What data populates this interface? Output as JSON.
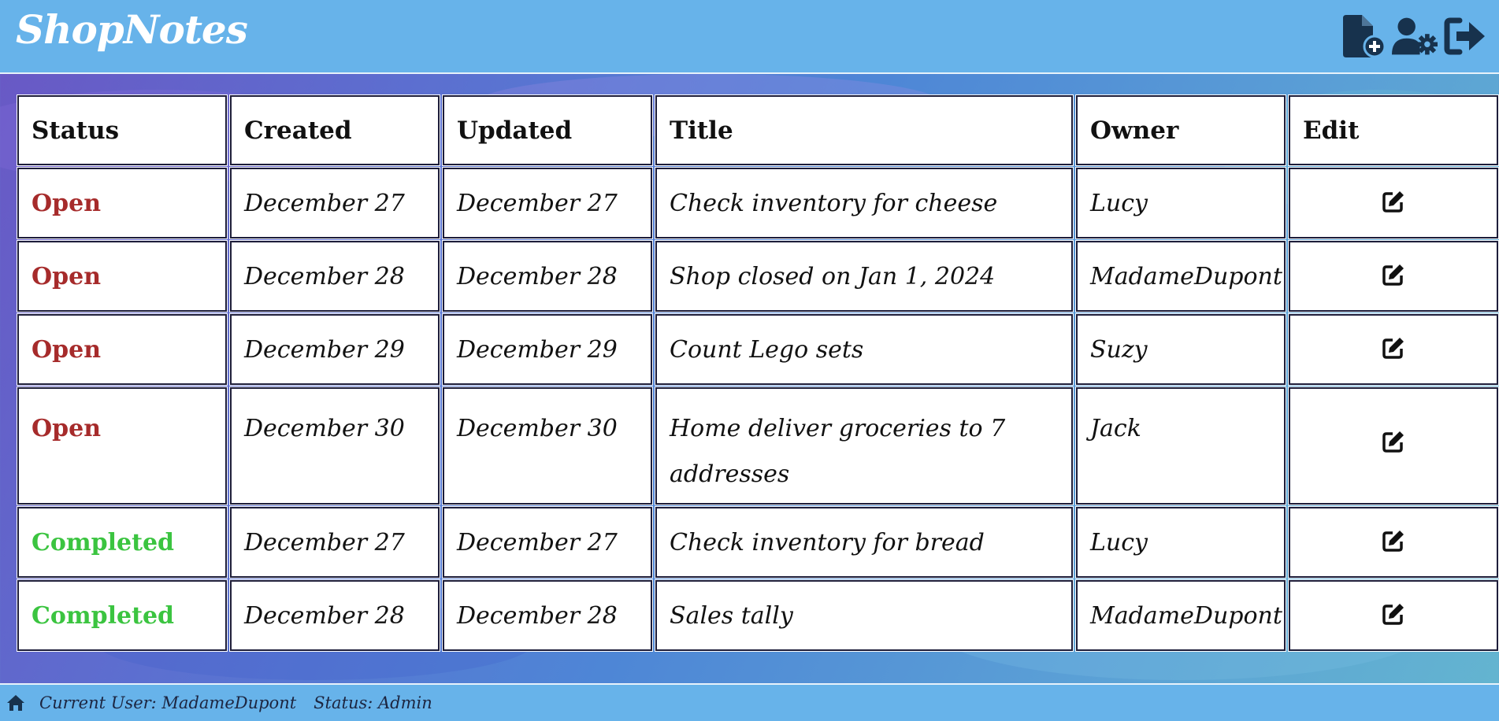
{
  "app": {
    "title": "ShopNotes"
  },
  "header": {
    "icons": [
      "new-note-icon",
      "user-settings-icon",
      "logout-icon"
    ]
  },
  "table": {
    "columns": [
      "Status",
      "Created",
      "Updated",
      "Title",
      "Owner",
      "Edit"
    ],
    "rows": [
      {
        "status": "Open",
        "created": "December 27",
        "updated": "December 27",
        "title": "Check inventory for cheese",
        "owner": "Lucy"
      },
      {
        "status": "Open",
        "created": "December 28",
        "updated": "December 28",
        "title": "Shop closed on Jan 1, 2024",
        "owner": "MadameDupont"
      },
      {
        "status": "Open",
        "created": "December 29",
        "updated": "December 29",
        "title": "Count Lego sets",
        "owner": "Suzy"
      },
      {
        "status": "Open",
        "created": "December 30",
        "updated": "December 30",
        "title": "Home deliver groceries to 7 addresses",
        "owner": "Jack"
      },
      {
        "status": "Completed",
        "created": "December 27",
        "updated": "December 27",
        "title": "Check inventory for bread",
        "owner": "Lucy"
      },
      {
        "status": "Completed",
        "created": "December 28",
        "updated": "December 28",
        "title": "Sales tally",
        "owner": "MadameDupont"
      }
    ]
  },
  "footer": {
    "current_user": "Current User: MadameDupont",
    "status": "Status: Admin"
  },
  "colors": {
    "header_bg": "#67b3ea",
    "open": "#a62b2b",
    "completed": "#3bc440"
  }
}
